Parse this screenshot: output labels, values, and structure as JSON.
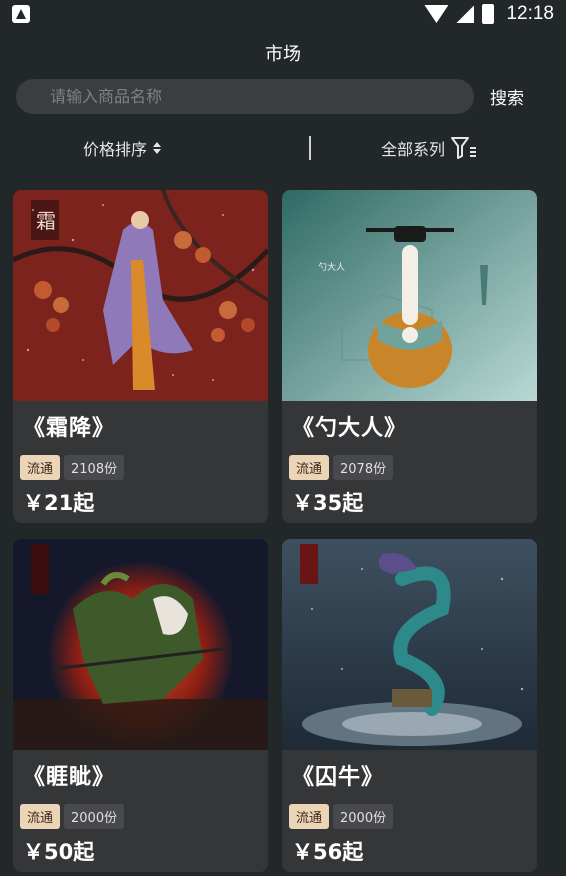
{
  "status_bar": {
    "time": "12:18"
  },
  "header": {
    "title": "市场"
  },
  "search": {
    "placeholder": "请输入商品名称",
    "button_label": "搜索"
  },
  "filters": {
    "sort_label": "价格排序",
    "series_label": "全部系列"
  },
  "products": [
    {
      "name": "《霜降》",
      "tag": "流通",
      "count": "2108份",
      "price": "￥21起"
    },
    {
      "name": "《勺大人》",
      "tag": "流通",
      "count": "2078份",
      "price": "￥35起"
    },
    {
      "name": "《睚眦》",
      "tag": "流通",
      "count": "2000份",
      "price": "￥50起"
    },
    {
      "name": "《囚牛》",
      "tag": "流通",
      "count": "2000份",
      "price": "￥56起"
    }
  ]
}
